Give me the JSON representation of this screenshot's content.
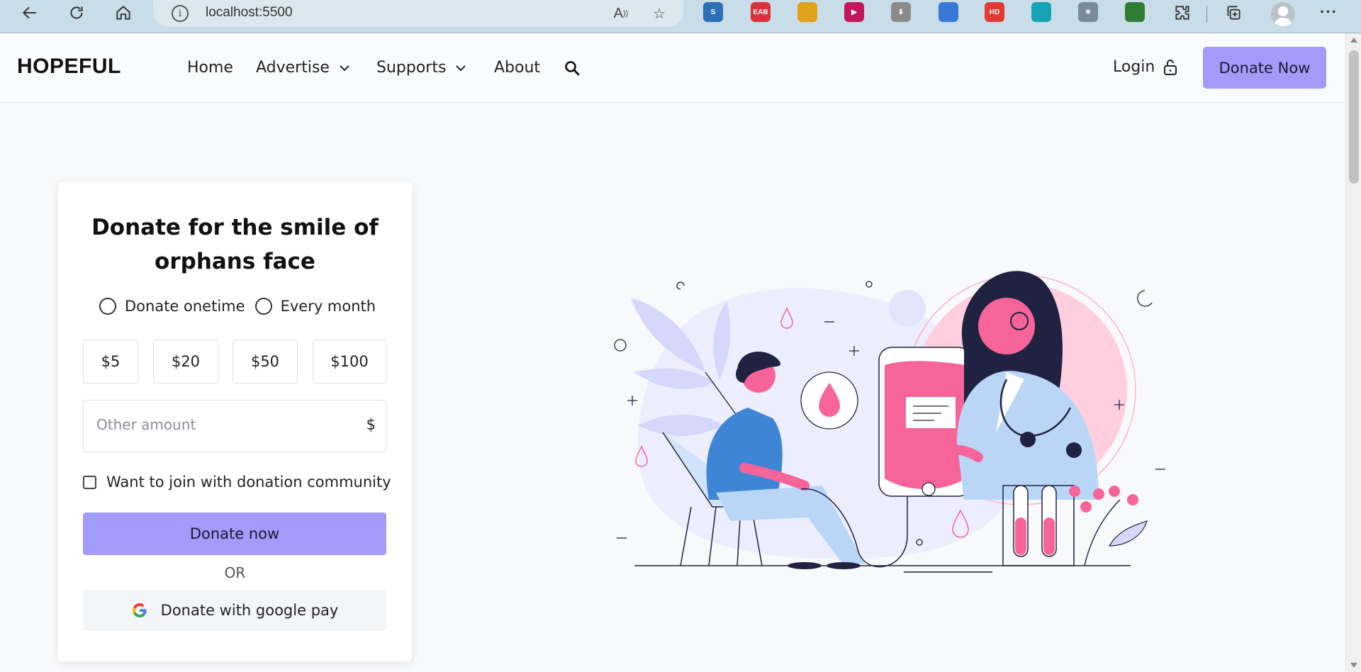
{
  "browser": {
    "url": "localhost:5500",
    "nav_icons": [
      "back-arrow-icon",
      "refresh-icon",
      "home-icon"
    ],
    "addr_icons": [
      "read-aloud-icon",
      "add-favorite-icon"
    ],
    "extensions": [
      {
        "name": "s-extension-icon",
        "label": "S",
        "color": "#2b6fb6"
      },
      {
        "name": "adblock-extension-icon",
        "label": "EAB",
        "color": "#d9323b"
      },
      {
        "name": "clipboard-extension-icon",
        "label": "",
        "color": "#e2a21c"
      },
      {
        "name": "video-extension-icon",
        "label": "▶",
        "color": "#c2185b"
      },
      {
        "name": "download-extension-icon",
        "label": "⬇",
        "color": "#8a8a8a"
      },
      {
        "name": "color-extension-icon",
        "label": "",
        "color": "#3a78d8"
      },
      {
        "name": "hd-extension-icon",
        "label": "HD",
        "color": "#e53935"
      },
      {
        "name": "shield-extension-icon",
        "label": "",
        "color": "#17a2b8"
      },
      {
        "name": "react-extension-icon",
        "label": "⚛",
        "color": "#7a8a9a"
      },
      {
        "name": "devtools-extension-icon",
        "label": "",
        "color": "#2e7d32"
      }
    ],
    "right_icons": [
      "extensions-puzzle-icon",
      "collections-icon",
      "profile-avatar-icon",
      "more-menu-icon"
    ],
    "more_label": "···"
  },
  "header": {
    "logo": "HOPEFUL",
    "nav": [
      {
        "label": "Home",
        "dropdown": false
      },
      {
        "label": "Advertise",
        "dropdown": true
      },
      {
        "label": "Supports",
        "dropdown": true
      },
      {
        "label": "About",
        "dropdown": false
      }
    ],
    "login_label": "Login",
    "donate_label": "Donate Now"
  },
  "form": {
    "title": "Donate for the smile of orphans face",
    "radio_onetime": "Donate onetime",
    "radio_monthly": "Every month",
    "amounts": [
      "$5",
      "$20",
      "$50",
      "$100"
    ],
    "other_placeholder": "Other amount",
    "currency": "$",
    "community_label": "Want to join with donation community",
    "donate_button": "Donate now",
    "or_text": "OR",
    "gpay_label": "Donate with google pay"
  },
  "colors": {
    "accent": "#a29bfa",
    "pink": "#f7649a",
    "light_pink": "#ffc7d8",
    "lavender": "#d5d7fb",
    "navy": "#1f2240",
    "blue": "#3f85d6",
    "light_blue": "#b9d6f7"
  }
}
